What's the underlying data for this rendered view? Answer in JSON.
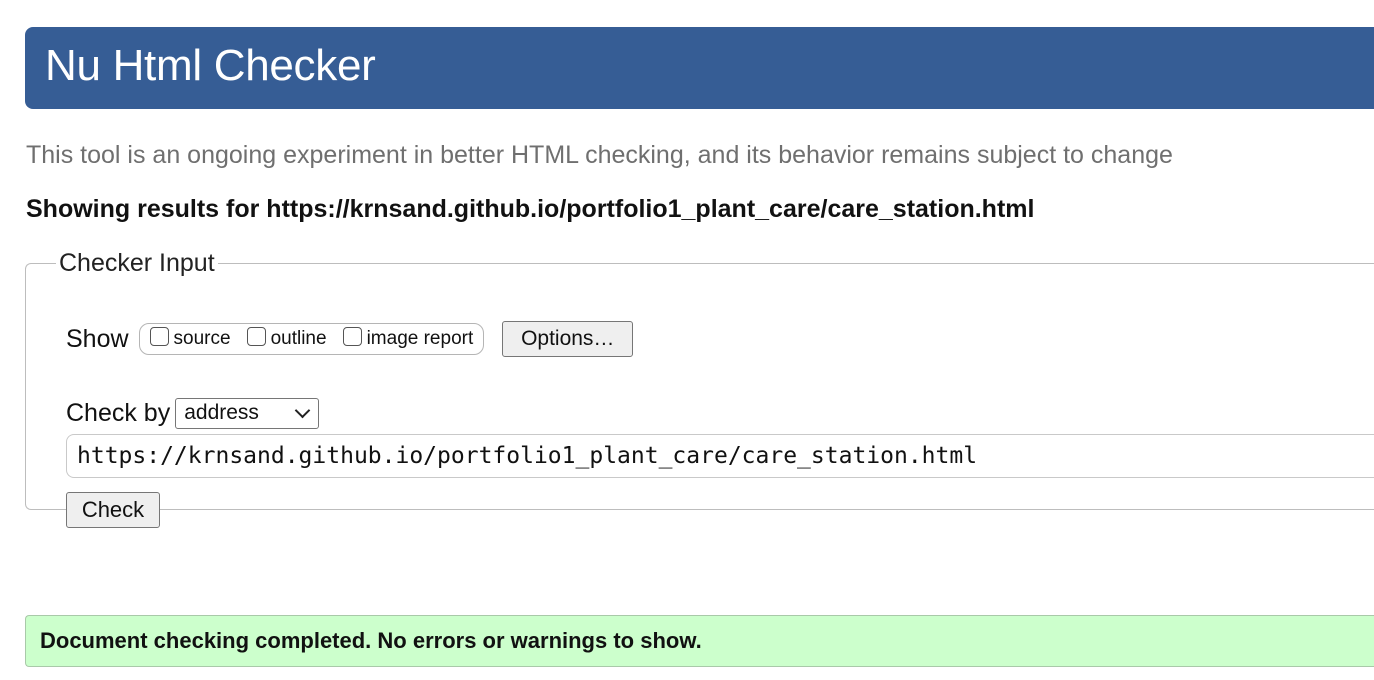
{
  "header": {
    "title": "Nu Html Checker"
  },
  "intro": "This tool is an ongoing experiment in better HTML checking, and its behavior remains subject to change",
  "results_for": "Showing results for https://krnsand.github.io/portfolio1_plant_care/care_station.html",
  "checker_input": {
    "legend": "Checker Input",
    "show_label": "Show",
    "show_options": [
      {
        "label": "source",
        "checked": false
      },
      {
        "label": "outline",
        "checked": false
      },
      {
        "label": "image report",
        "checked": false
      }
    ],
    "options_button": "Options…",
    "check_by_label": "Check by",
    "check_by_selected": "address",
    "url_value": "https://krnsand.github.io/portfolio1_plant_care/care_station.html",
    "check_button": "Check"
  },
  "status": {
    "message": "Document checking completed. No errors or warnings to show.",
    "color": "#ccffcc"
  },
  "colors": {
    "header_bg": "#365d95",
    "header_text": "#ffffff",
    "intro_text": "#6f6f6f"
  },
  "icons": {
    "select_chevron": "chevron-down-icon"
  }
}
